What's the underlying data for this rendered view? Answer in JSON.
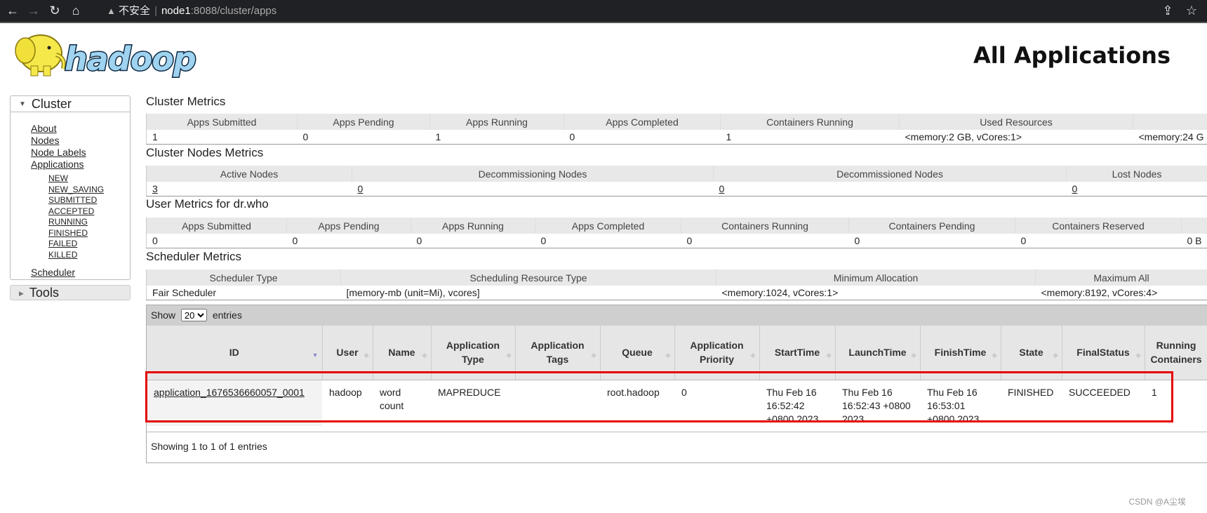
{
  "browser": {
    "security_warning": "不安全",
    "url_host": "node1",
    "url_path": ":8088/cluster/apps"
  },
  "logo_text": "hadoop",
  "page_title": "All Applications",
  "sidebar": {
    "cluster_label": "Cluster",
    "links": [
      "About",
      "Nodes",
      "Node Labels",
      "Applications"
    ],
    "app_states": [
      "NEW",
      "NEW_SAVING",
      "SUBMITTED",
      "ACCEPTED",
      "RUNNING",
      "FINISHED",
      "FAILED",
      "KILLED"
    ],
    "scheduler_label": "Scheduler",
    "tools_label": "Tools"
  },
  "cluster_metrics": {
    "title": "Cluster Metrics",
    "headers": [
      "Apps Submitted",
      "Apps Pending",
      "Apps Running",
      "Apps Completed",
      "Containers Running",
      "Used Resources",
      ""
    ],
    "values": [
      "1",
      "0",
      "1",
      "0",
      "1",
      "<memory:2 GB, vCores:1>",
      "<memory:24 G"
    ]
  },
  "cluster_nodes_metrics": {
    "title": "Cluster Nodes Metrics",
    "headers": [
      "Active Nodes",
      "Decommissioning Nodes",
      "Decommissioned Nodes",
      "Lost Nodes"
    ],
    "values": [
      "3",
      "0",
      "0",
      "0"
    ]
  },
  "user_metrics": {
    "title": "User Metrics for dr.who",
    "headers": [
      "Apps Submitted",
      "Apps Pending",
      "Apps Running",
      "Apps Completed",
      "Containers Running",
      "Containers Pending",
      "Containers Reserved",
      ""
    ],
    "values": [
      "0",
      "0",
      "0",
      "0",
      "0",
      "0",
      "0",
      "0 B"
    ]
  },
  "scheduler_metrics": {
    "title": "Scheduler Metrics",
    "headers": [
      "Scheduler Type",
      "Scheduling Resource Type",
      "Minimum Allocation",
      "Maximum All"
    ],
    "values": [
      "Fair Scheduler",
      "[memory-mb (unit=Mi), vcores]",
      "<memory:1024, vCores:1>",
      "<memory:8192, vCores:4>"
    ]
  },
  "apps_table": {
    "show_label": "Show",
    "page_size": "20",
    "entries_label": "entries",
    "headers": [
      "ID",
      "User",
      "Name",
      "Application Type",
      "Application Tags",
      "Queue",
      "Application Priority",
      "StartTime",
      "LaunchTime",
      "FinishTime",
      "State",
      "FinalStatus",
      "Running Containers"
    ],
    "sorted_column": "ID",
    "rows": [
      [
        "application_1676536660057_0001",
        "hadoop",
        "word count",
        "MAPREDUCE",
        "",
        "root.hadoop",
        "0",
        "Thu Feb 16 16:52:42 +0800 2023",
        "Thu Feb 16 16:52:43 +0800 2023",
        "Thu Feb 16 16:53:01 +0800 2023",
        "FINISHED",
        "SUCCEEDED",
        "1"
      ]
    ],
    "showing_text": "Showing 1 to 1 of 1 entries"
  },
  "highlight_color": "#e50000",
  "watermark": "CSDN @A尘埃"
}
